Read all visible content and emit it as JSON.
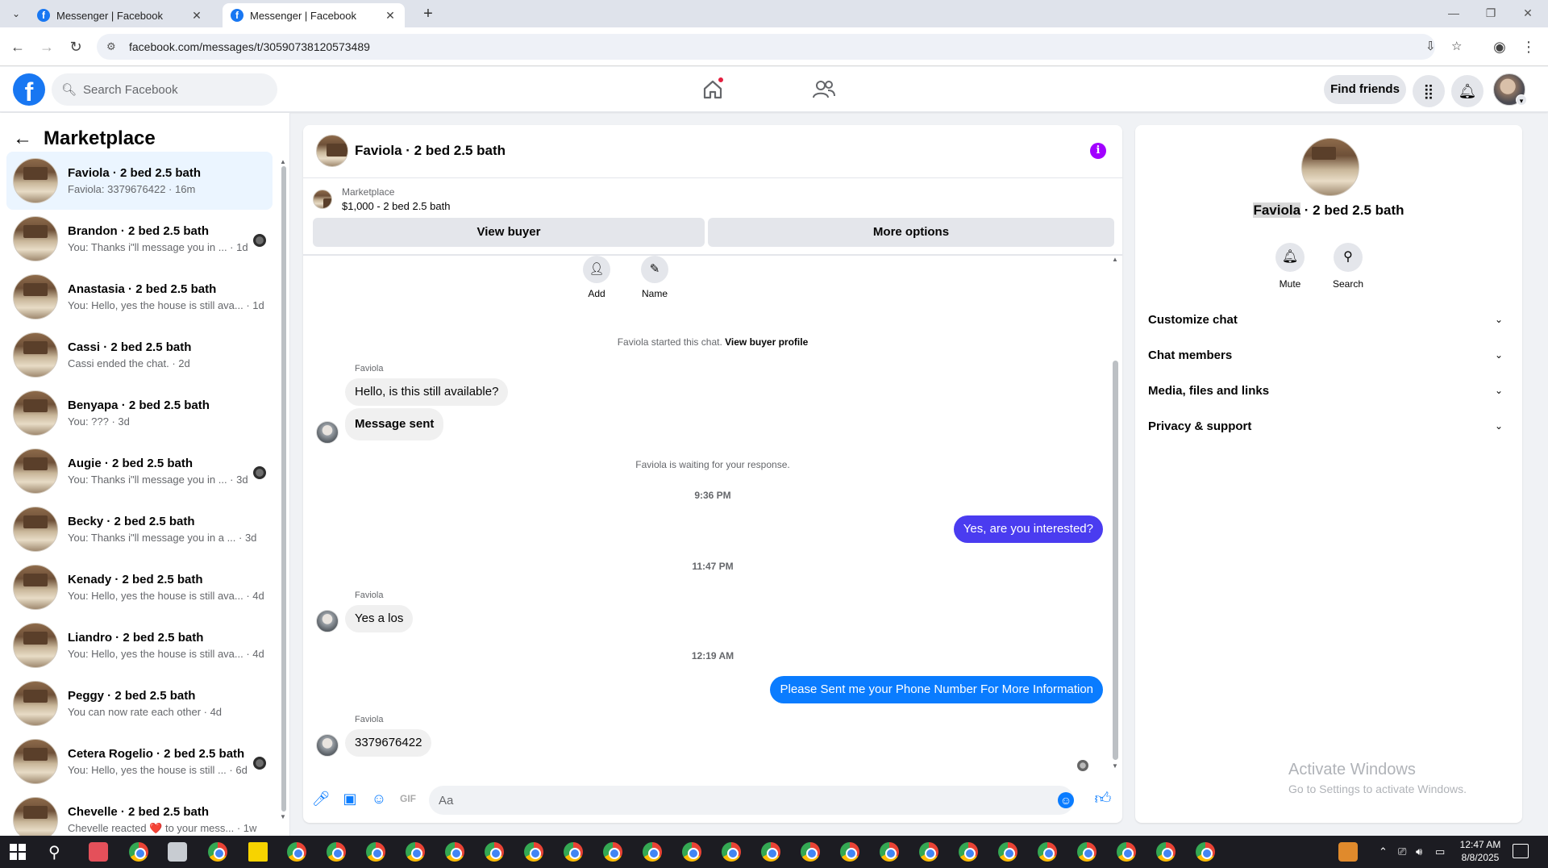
{
  "browser": {
    "tabs": [
      {
        "title": "Messenger | Facebook",
        "active": false
      },
      {
        "title": "Messenger | Facebook",
        "active": true
      }
    ],
    "url": "facebook.com/messages/t/30590738120573489"
  },
  "fb": {
    "search_placeholder": "Search Facebook",
    "find_friends": "Find friends"
  },
  "left": {
    "title": "Marketplace",
    "conversations": [
      {
        "name": "Faviola · 2 bed 2.5 bath",
        "preview": "Faviola: 3379676422 · 16m",
        "active": true
      },
      {
        "name": "Brandon · 2 bed 2.5 bath",
        "preview": "You: Thanks i\"ll message you in ... · 1d"
      },
      {
        "name": "Anastasia · 2 bed 2.5 bath",
        "preview": "You: Hello, yes the house is still ava... · 1d"
      },
      {
        "name": "Cassi · 2 bed 2.5 bath",
        "preview": "Cassi ended the chat. · 2d"
      },
      {
        "name": "Benyapa · 2 bed 2.5 bath",
        "preview": "You: ??? · 3d"
      },
      {
        "name": "Augie · 2 bed 2.5 bath",
        "preview": "You: Thanks i\"ll message you in ... · 3d"
      },
      {
        "name": "Becky · 2 bed 2.5 bath",
        "preview": "You: Thanks i\"ll message you in a ... · 3d"
      },
      {
        "name": "Kenady · 2 bed 2.5 bath",
        "preview": "You: Hello, yes the house is still ava... · 4d"
      },
      {
        "name": "Liandro · 2 bed 2.5 bath",
        "preview": "You: Hello, yes the house is still ava... · 4d"
      },
      {
        "name": "Peggy · 2 bed 2.5 bath",
        "preview": "You can now rate each other · 4d"
      },
      {
        "name": "Cetera Rogelio · 2 bed 2.5 bath",
        "preview": "You: Hello, yes the house is still ... · 6d"
      },
      {
        "name": "Chevelle · 2 bed 2.5 bath",
        "preview": "Chevelle reacted ❤️ to your mess... · 1w"
      }
    ]
  },
  "chat": {
    "title": "Faviola · 2 bed 2.5 bath",
    "marketplace_label": "Marketplace",
    "listing": "$1,000 - 2 bed 2.5 bath",
    "view_buyer": "View buyer",
    "more_options": "More options",
    "quick_add": "Add",
    "quick_name": "Name",
    "started_text": "Faviola started this chat.",
    "view_buyer_profile": "View buyer profile",
    "sender_name": "Faviola",
    "msg1": "Hello, is this still available?",
    "msg2": "Message sent",
    "waiting": "Faviola is waiting for your response.",
    "time1": "9:36 PM",
    "out1": "Yes, are you interested?",
    "time2": "11:47 PM",
    "msg3": "Yes a los",
    "time3": "12:19 AM",
    "out2": "Please Sent me your Phone Number For More Information",
    "msg4": "3379676422",
    "composer_placeholder": "Aa"
  },
  "right": {
    "name_highlight": "Faviola",
    "name_rest": " · 2 bed 2.5 bath",
    "mute": "Mute",
    "search": "Search",
    "sections": [
      "Customize chat",
      "Chat members",
      "Media, files and links",
      "Privacy & support"
    ],
    "watermark_title": "Activate Windows",
    "watermark_sub": "Go to Settings to activate Windows."
  },
  "taskbar": {
    "time": "12:47 AM",
    "date": "8/8/2025"
  },
  "colors": {
    "fb_blue": "#1877f2",
    "outgoing_purple": "#4a3cf0",
    "outgoing_blue": "#0a7cff",
    "info_purple": "#a100ff"
  }
}
